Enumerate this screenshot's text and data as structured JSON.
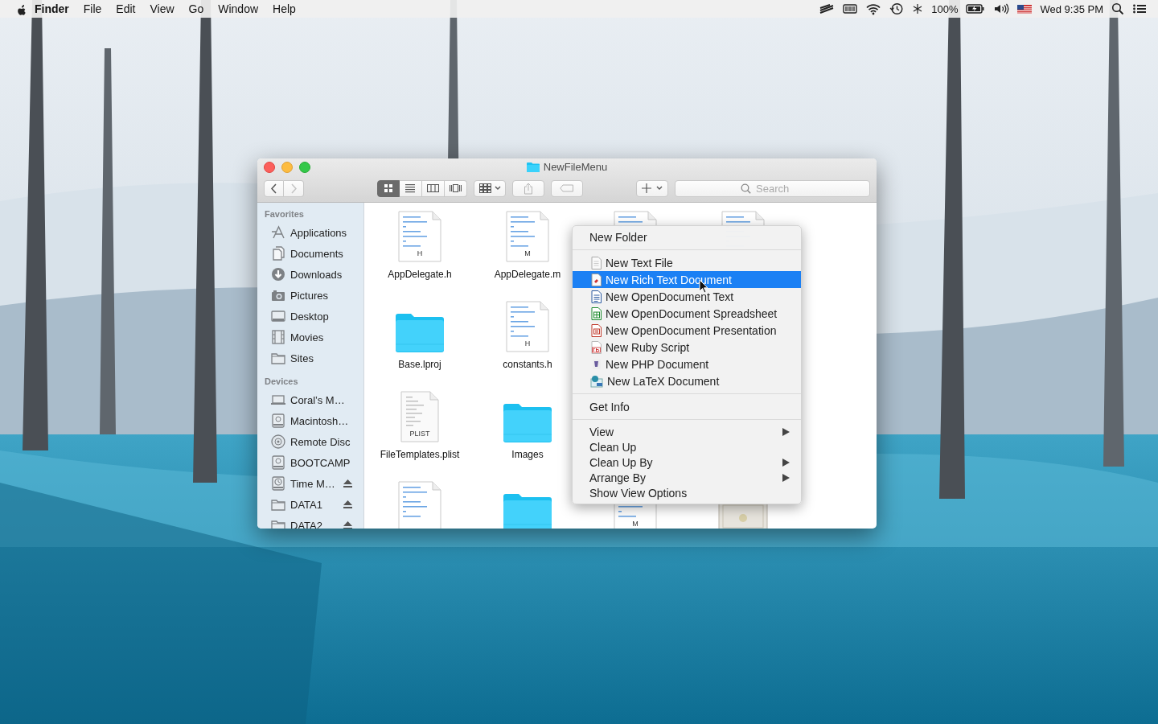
{
  "menubar": {
    "app": "Finder",
    "menus": [
      "File",
      "Edit",
      "View",
      "Go",
      "Window",
      "Help"
    ],
    "battery": "100%",
    "clock": "Wed 9:35 PM"
  },
  "window": {
    "title": "NewFileMenu",
    "nav_buttons": [
      {
        "kind": "back",
        "disabled": false
      },
      {
        "kind": "forward",
        "disabled": true
      }
    ],
    "view_modes": [
      {
        "kind": "icons",
        "selected": true
      },
      {
        "kind": "list",
        "selected": false
      },
      {
        "kind": "columns",
        "selected": false
      },
      {
        "kind": "coverflow",
        "selected": false
      }
    ],
    "search": {
      "placeholder": "Search"
    }
  },
  "sidebar": {
    "sections": [
      {
        "heading": "Favorites",
        "items": [
          {
            "label": "Applications",
            "kind": "apps",
            "eject": false
          },
          {
            "label": "Documents",
            "kind": "documents",
            "eject": false
          },
          {
            "label": "Downloads",
            "kind": "downloads",
            "eject": false
          },
          {
            "label": "Pictures",
            "kind": "camera",
            "eject": false
          },
          {
            "label": "Desktop",
            "kind": "monitor",
            "eject": false
          },
          {
            "label": "Movies",
            "kind": "film",
            "eject": false
          },
          {
            "label": "Sites",
            "kind": "folder",
            "eject": false
          }
        ]
      },
      {
        "heading": "Devices",
        "items": [
          {
            "label": "Coral’s M…",
            "kind": "laptop",
            "eject": false
          },
          {
            "label": "Macintosh…",
            "kind": "drive",
            "eject": false
          },
          {
            "label": "Remote Disc",
            "kind": "disc",
            "eject": false
          },
          {
            "label": "BOOTCAMP",
            "kind": "drive",
            "eject": false
          },
          {
            "label": "Time M…",
            "kind": "clockdrive",
            "eject": true
          },
          {
            "label": "DATA1",
            "kind": "folder",
            "eject": true
          },
          {
            "label": "DATA2",
            "kind": "folder",
            "eject": true
          }
        ]
      }
    ]
  },
  "files": [
    {
      "kind": "doc",
      "name": "AppDelegate.h",
      "badge": "H"
    },
    {
      "kind": "doc",
      "name": "AppDelegate.m",
      "badge": "M"
    },
    {
      "kind": "doc"
    },
    {
      "kind": "doc"
    },
    {
      "kind": "folder",
      "name": "Base.lproj"
    },
    {
      "kind": "doc",
      "name": "constants.h",
      "badge": "H"
    },
    {
      "kind": "blank"
    },
    {
      "kind": "blank"
    },
    {
      "kind": "plist",
      "name": "FileTemplates.plist",
      "badge": "PLIST"
    },
    {
      "kind": "folder",
      "name": "Images"
    },
    {
      "kind": "blank"
    },
    {
      "kind": "blank"
    },
    {
      "kind": "doc"
    },
    {
      "kind": "folder"
    },
    {
      "kind": "doc",
      "badge": "M"
    },
    {
      "kind": "certificate"
    }
  ],
  "context_menu": {
    "sections": [
      {
        "items": [
          {
            "label": "New Folder",
            "kind": "plain",
            "selected": false,
            "submenu": false
          }
        ]
      },
      {
        "items": [
          {
            "label": "New Text File",
            "kind": "text",
            "selected": false,
            "submenu": false
          },
          {
            "label": "New Rich Text Document",
            "kind": "rich",
            "selected": true,
            "submenu": false
          },
          {
            "label": "New OpenDocument Text",
            "kind": "odt",
            "selected": false,
            "submenu": false
          },
          {
            "label": "New OpenDocument Spreadsheet",
            "kind": "ods",
            "selected": false,
            "submenu": false
          },
          {
            "label": "New OpenDocument Presentation",
            "kind": "odp",
            "selected": false,
            "submenu": false
          },
          {
            "label": "New Ruby Script",
            "kind": "ruby",
            "selected": false,
            "submenu": false
          },
          {
            "label": "New PHP Document",
            "kind": "php",
            "selected": false,
            "submenu": false
          },
          {
            "label": "New LaTeX Document",
            "kind": "latex",
            "selected": false,
            "submenu": false
          }
        ]
      },
      {
        "items": [
          {
            "label": "Get Info",
            "kind": "plain",
            "selected": false,
            "submenu": false
          }
        ]
      },
      {
        "items": [
          {
            "label": "View",
            "kind": "plain",
            "selected": false,
            "submenu": true
          },
          {
            "label": "Clean Up",
            "kind": "plain",
            "selected": false,
            "submenu": false
          },
          {
            "label": "Clean Up By",
            "kind": "plain",
            "selected": false,
            "submenu": true
          },
          {
            "label": "Arrange By",
            "kind": "plain",
            "selected": false,
            "submenu": true
          },
          {
            "label": "Show View Options",
            "kind": "plain",
            "selected": false,
            "submenu": false
          }
        ]
      }
    ]
  }
}
